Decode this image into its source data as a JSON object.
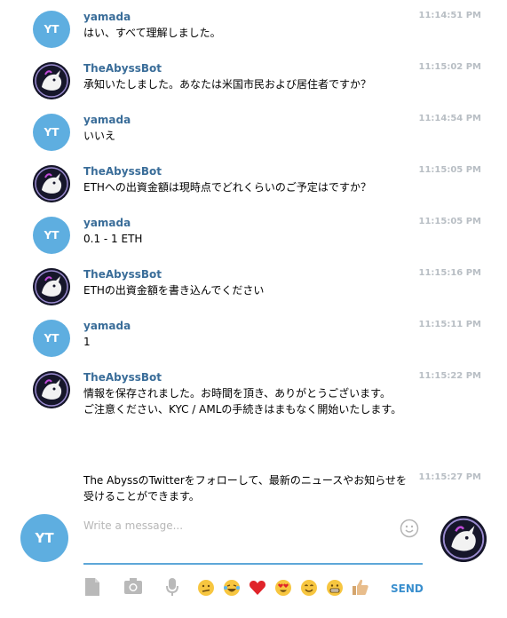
{
  "messages": [
    {
      "sender": "yamada",
      "avatar_text": "YT",
      "time": "11:14:51 PM",
      "text": "はい、すべて理解しました。"
    },
    {
      "sender": "TheAbyssBot",
      "time": "11:15:02 PM",
      "text": "承知いたしました。あなたは米国市民および居住者ですか？"
    },
    {
      "sender": "yamada",
      "avatar_text": "YT",
      "time": "11:14:54 PM",
      "text": "いいえ"
    },
    {
      "sender": "TheAbyssBot",
      "time": "11:15:05 PM",
      "text": "ETHへの出資金額は現時点でどれくらいのご予定はですか？"
    },
    {
      "sender": "yamada",
      "avatar_text": "YT",
      "time": "11:15:05 PM",
      "text": "0.1 - 1 ETH"
    },
    {
      "sender": "TheAbyssBot",
      "time": "11:15:16 PM",
      "text": "ETHの出資金額を書き込んでください"
    },
    {
      "sender": "yamada",
      "avatar_text": "YT",
      "time": "11:15:11 PM",
      "text": "1"
    },
    {
      "sender": "TheAbyssBot",
      "time": "11:15:22 PM",
      "text": "情報を保存されました。お時間を頂き、ありがとうございます。\nご注意ください、KYC / AMLの手続きはまもなく開始いたします。"
    },
    {
      "time": "11:15:27 PM",
      "text": "The AbyssのTwitterをフォローして、最新のニュースやお知らせを受けることができます。"
    }
  ],
  "compose": {
    "avatar_text": "YT",
    "placeholder": "Write a message...",
    "value": "",
    "send_label": "SEND"
  },
  "toolbar": {
    "icons": [
      "document-icon",
      "camera-icon",
      "microphone-icon",
      "emoji-confused-icon",
      "emoji-laughing-tears-icon",
      "heart-icon",
      "emoji-heart-eyes-icon",
      "emoji-smile-icon",
      "emoji-grin-icon",
      "thumbs-up-icon"
    ]
  },
  "colors": {
    "accent": "#5ea7d8",
    "sender_name": "#3a6d99",
    "avatar_bg": "#5eaee0",
    "send": "#3a8fce",
    "timestamp": "#b8bec4"
  }
}
